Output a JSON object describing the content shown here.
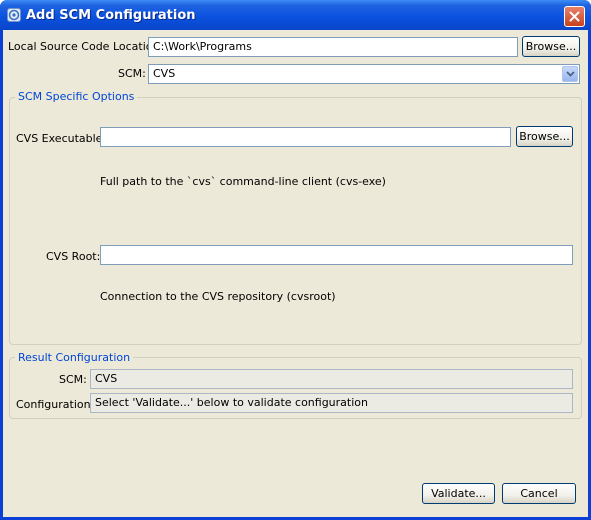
{
  "window": {
    "title": "Add SCM Configuration"
  },
  "form": {
    "local_source_label": "Local Source Code Location:",
    "local_source_value": "C:\\Work\\Programs",
    "local_browse_label": "Browse...",
    "scm_label": "SCM:",
    "scm_selected": "CVS"
  },
  "scm_options": {
    "group_title": "SCM Specific Options",
    "cvs_executable_label": "CVS Executable:",
    "cvs_executable_value": "",
    "cvs_browse_label": "Browse...",
    "cvs_executable_help": "Full path to the `cvs` command-line client (cvs-exe)",
    "cvs_root_label": "CVS Root:",
    "cvs_root_value": "",
    "cvs_root_help": "Connection to the CVS repository (cvsroot)"
  },
  "result": {
    "group_title": "Result Configuration",
    "scm_label": "SCM:",
    "scm_value": "CVS",
    "config_label": "Configuration:",
    "config_value": "Select 'Validate...' below to validate configuration"
  },
  "buttons": {
    "validate_label": "Validate...",
    "cancel_label": "Cancel"
  }
}
